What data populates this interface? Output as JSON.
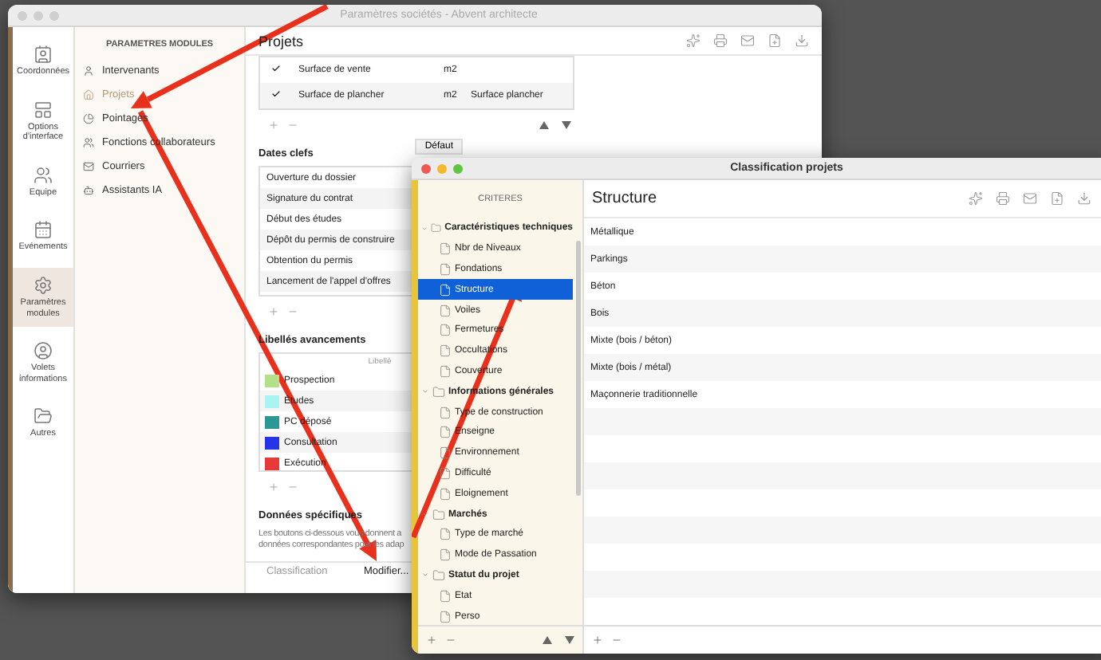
{
  "main_window": {
    "title": "Paramètres sociétés - Abvent architecte",
    "nav": [
      {
        "label": "Coordonnées",
        "selected": false
      },
      {
        "label": "Options d'interface",
        "selected": false
      },
      {
        "label": "Equipe",
        "selected": false
      },
      {
        "label": "Evénements",
        "selected": false
      },
      {
        "label": "Paramètres modules",
        "selected": true
      },
      {
        "label": "Volets informations",
        "selected": false
      },
      {
        "label": "Autres",
        "selected": false
      }
    ],
    "modules": {
      "title": "PARAMETRES MODULES",
      "items": [
        {
          "label": "Intervenants",
          "selected": false
        },
        {
          "label": "Projets",
          "selected": true
        },
        {
          "label": "Pointages",
          "selected": false
        },
        {
          "label": "Fonctions collaborateurs",
          "selected": false
        },
        {
          "label": "Courriers",
          "selected": false
        },
        {
          "label": "Assistants IA",
          "selected": false
        }
      ]
    },
    "content": {
      "title": "Projets",
      "surfaces": [
        {
          "checked": true,
          "name": "Surface de vente",
          "unit": "m2"
        },
        {
          "checked": true,
          "name": "Surface de plancher",
          "unit": "m2",
          "label": "Surface plancher"
        }
      ],
      "dates": {
        "title": "Dates clefs",
        "tab": "Défaut",
        "rows": [
          "Ouverture du dossier",
          "Signature du contrat",
          "Début des études",
          "Dépôt du permis de construire",
          "Obtention du permis",
          "Lancement de l'appel d'offres"
        ]
      },
      "avancements": {
        "title": "Libellés avancements",
        "column": "Libellé",
        "rows": [
          {
            "label": "Prospection",
            "color": "#b4e08a"
          },
          {
            "label": "Études",
            "color": "#a9f3f3"
          },
          {
            "label": "PC déposé",
            "color": "#2a9896"
          },
          {
            "label": "Consultation",
            "color": "#2434e6"
          },
          {
            "label": "Exécution",
            "color": "#e8383a"
          }
        ]
      },
      "specific": {
        "title": "Données spécifiques",
        "lines": [
          "Les boutons ci-dessous vous donnent a",
          "données correspondantes pour les adap"
        ],
        "field": "Classification",
        "button": "Modifier..."
      }
    }
  },
  "dialog": {
    "title": "Classification projets",
    "sidebar": {
      "title": "CRITERES",
      "groups": [
        {
          "label": "Caractéristiques techniques",
          "expanded": true,
          "children": [
            {
              "label": "Nbr de Niveaux",
              "selected": false
            },
            {
              "label": "Fondations",
              "selected": false
            },
            {
              "label": "Structure",
              "selected": true
            },
            {
              "label": "Voiles",
              "selected": false
            },
            {
              "label": "Fermetures",
              "selected": false
            },
            {
              "label": "Occultations",
              "selected": false
            },
            {
              "label": "Couverture",
              "selected": false
            }
          ]
        },
        {
          "label": "Informations générales",
          "expanded": true,
          "children": [
            {
              "label": "Type de construction",
              "selected": false
            },
            {
              "label": "Enseigne",
              "selected": false
            },
            {
              "label": "Environnement",
              "selected": false
            },
            {
              "label": "Difficulté",
              "selected": false
            },
            {
              "label": "Eloignement",
              "selected": false
            }
          ]
        },
        {
          "label": "Marchés",
          "expanded": true,
          "children": [
            {
              "label": "Type de marché",
              "selected": false
            },
            {
              "label": "Mode de Passation",
              "selected": false
            }
          ]
        },
        {
          "label": "Statut du projet",
          "expanded": true,
          "children": [
            {
              "label": "Etat",
              "selected": false
            },
            {
              "label": "Perso",
              "selected": false
            }
          ]
        }
      ]
    },
    "detail": {
      "title": "Structure",
      "values": [
        "Métallique",
        "Parkings",
        "Béton",
        "Bois",
        "Mixte (bois / béton)",
        "Mixte (bois / métal)",
        "Maçonnerie traditionnelle"
      ]
    }
  }
}
